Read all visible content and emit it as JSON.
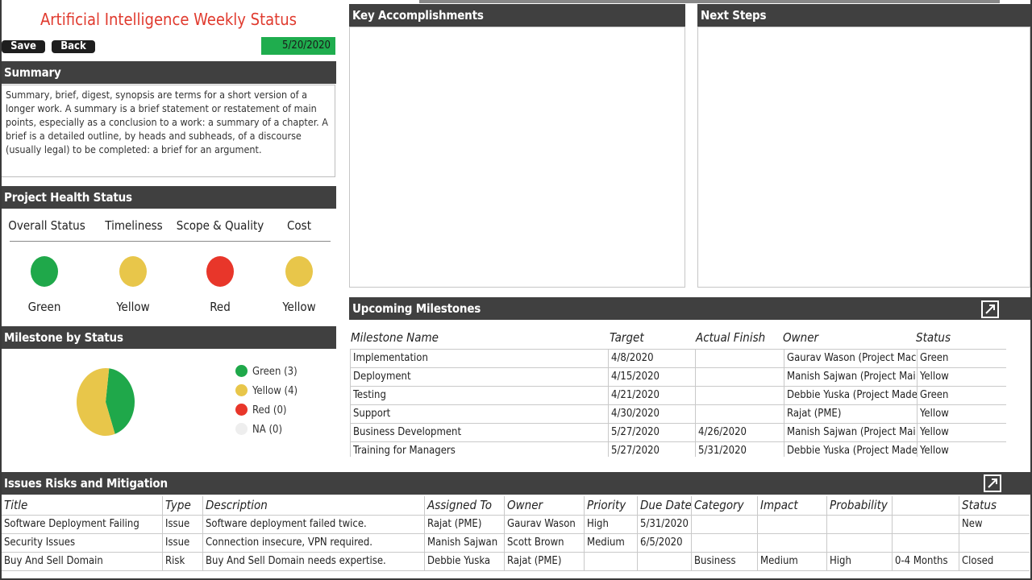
{
  "app": {
    "title": "Artificial Intelligence Weekly Status",
    "save_label": "Save",
    "back_label": "Back",
    "date": "5/20/2020"
  },
  "summary": {
    "heading": "Summary",
    "text": "Summary, brief, digest, synopsis are terms for a short version of a longer work. A summary is a brief statement or restatement of main points, especially as a conclusion to a work: a summary of a chapter. A brief is a detailed outline, by heads and subheads, of a discourse (usually legal) to be completed: a brief for an argument."
  },
  "health": {
    "heading": "Project Health Status",
    "items": [
      {
        "label": "Overall Status",
        "status": "Green",
        "color": "#1fa84a"
      },
      {
        "label": "Timeliness",
        "status": "Yellow",
        "color": "#e8c64a"
      },
      {
        "label": "Scope & Quality",
        "status": "Red",
        "color": "#e8362a"
      },
      {
        "label": "Cost",
        "status": "Yellow",
        "color": "#e8c64a"
      }
    ]
  },
  "milestone_status": {
    "heading": "Milestone by Status",
    "legend": [
      {
        "label": "Green (3)",
        "color": "#1fa84a"
      },
      {
        "label": "Yellow (4)",
        "color": "#e8c64a"
      },
      {
        "label": "Red (0)",
        "color": "#e8362a"
      },
      {
        "label": "NA (0)",
        "color": "#eeeeee"
      }
    ]
  },
  "chart_data": {
    "type": "pie",
    "categories": [
      "Green",
      "Yellow",
      "Red",
      "NA"
    ],
    "values": [
      3,
      4,
      0,
      0
    ],
    "colors": [
      "#1fa84a",
      "#e8c64a",
      "#e8362a",
      "#eeeeee"
    ]
  },
  "accomplishments": {
    "heading": "Key Accomplishments"
  },
  "next_steps": {
    "heading": "Next Steps"
  },
  "milestones": {
    "heading": "Upcoming Milestones",
    "columns": [
      "Milestone Name",
      "Target",
      "Actual Finish",
      "Owner",
      "Status"
    ],
    "rows": [
      [
        "Implementation",
        "4/8/2020",
        "",
        "Gaurav Wason (Project Mac",
        "Green"
      ],
      [
        "Deployment",
        "4/15/2020",
        "",
        "Manish Sajwan (Project Mai",
        "Yellow"
      ],
      [
        "Testing",
        "4/21/2020",
        "",
        "Debbie Yuska (Project Made",
        "Green"
      ],
      [
        "Support",
        "4/30/2020",
        "",
        "Rajat (PME)",
        "Yellow"
      ],
      [
        "Business Development",
        "5/27/2020",
        "4/26/2020",
        "Manish Sajwan (Project Mai",
        "Yellow"
      ],
      [
        "Training for Managers",
        "5/27/2020",
        "5/31/2020",
        "Debbie Yuska (Project Made",
        "Yellow"
      ]
    ]
  },
  "issues": {
    "heading": "Issues Risks and Mitigation",
    "columns": [
      "Title",
      "Type",
      "Description",
      "Assigned To",
      "Owner",
      "Priority",
      "Due Date",
      "Category",
      "Impact",
      "Probability",
      "",
      "Status"
    ],
    "rows": [
      [
        "Software Deployment Failing",
        "Issue",
        "Software deployment failed twice.",
        "Rajat (PME)",
        "Gaurav Wason",
        "High",
        "5/31/2020",
        "",
        "",
        "",
        "",
        "New"
      ],
      [
        "Security Issues",
        "Issue",
        "Connection insecure, VPN required.",
        "Manish Sajwan",
        "Scott Brown",
        "Medium",
        "6/5/2020",
        "",
        "",
        "",
        "",
        ""
      ],
      [
        "Buy And Sell Domain",
        "Risk",
        "Buy And Sell Domain needs expertise.",
        "Debbie Yuska",
        "Rajat (PME)",
        "",
        "",
        "Business",
        "Medium",
        "High",
        "0-4 Months",
        "Closed"
      ]
    ]
  }
}
